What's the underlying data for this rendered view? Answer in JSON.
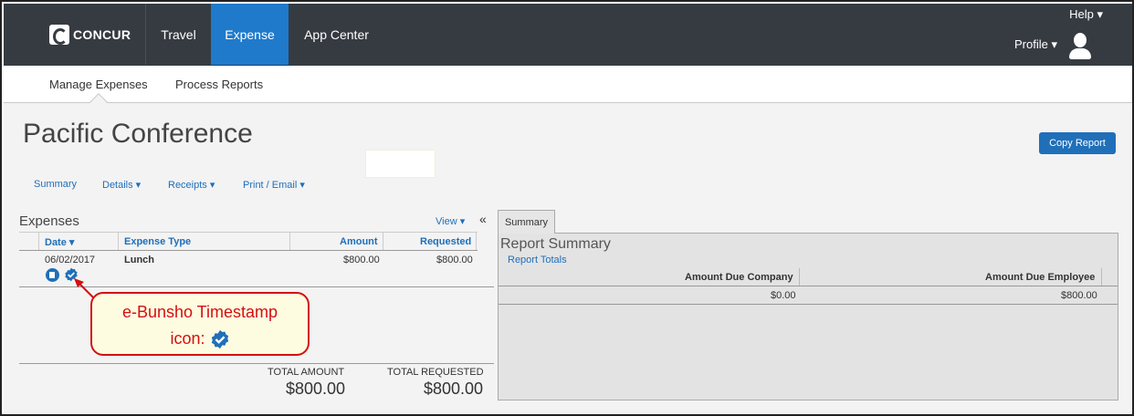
{
  "topnav": {
    "logo_text": "CONCUR",
    "items": [
      {
        "label": "Travel"
      },
      {
        "label": "Expense"
      },
      {
        "label": "App Center"
      }
    ],
    "help_label": "Help ▾",
    "profile_label": "Profile ▾",
    "active_color": "#1f7acb"
  },
  "subnav": {
    "items": [
      {
        "label": "Manage Expenses"
      },
      {
        "label": "Process Reports"
      }
    ]
  },
  "report": {
    "title": "Pacific Conference",
    "copy_button": "Copy Report",
    "tabs": [
      {
        "label": "Summary"
      },
      {
        "label": "Details ▾"
      },
      {
        "label": "Receipts ▾"
      },
      {
        "label": "Print / Email ▾"
      }
    ]
  },
  "expenses": {
    "heading": "Expenses",
    "view_label": "View ▾",
    "collapse_label": "«",
    "columns": [
      "Date ▾",
      "Expense Type",
      "Amount",
      "Requested"
    ],
    "rows": [
      {
        "date": "06/02/2017",
        "type": "Lunch",
        "amount": "$800.00",
        "requested": "$800.00",
        "icons": [
          "receipt-image-icon",
          "e-bunsho-timestamp-icon"
        ]
      }
    ],
    "total_amount_label": "TOTAL AMOUNT",
    "total_amount": "$800.00",
    "total_requested_label": "TOTAL REQUESTED",
    "total_requested": "$800.00"
  },
  "callout": {
    "line1": "e-Bunsho Timestamp",
    "line2": "icon:",
    "color": "#d41010"
  },
  "summary": {
    "tab_label": "Summary",
    "title": "Report Summary",
    "link": "Report Totals",
    "columns": [
      "Amount Due Company",
      "Amount Due Employee"
    ],
    "values": [
      "$0.00",
      "$800.00"
    ]
  }
}
